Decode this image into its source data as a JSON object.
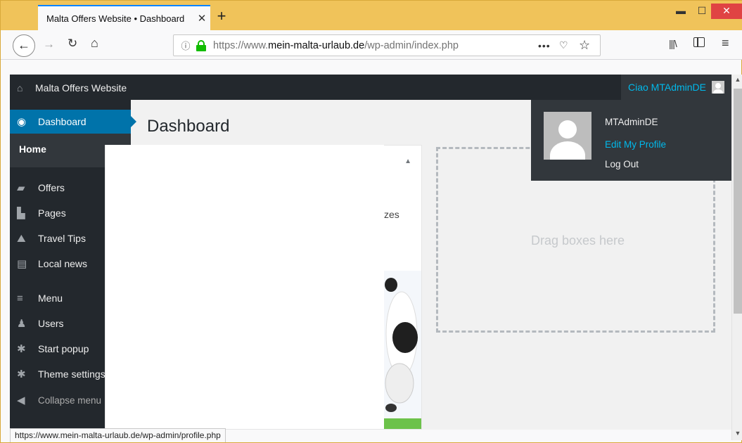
{
  "browser": {
    "tab_title": "Malta Offers Website • Dashboard",
    "tab_close": "✕",
    "new_tab": "+",
    "window_controls": {
      "minimize": "▬",
      "maximize": "☐",
      "close": "✕"
    },
    "url_prefix": "https://www.",
    "url_domain": "mein-malta-urlaub.de",
    "url_path": "/wp-admin/index.php",
    "status_url": "https://www.mein-malta-urlaub.de/wp-admin/profile.php",
    "icons": {
      "back": "back-arrow-icon",
      "forward": "forward-arrow-icon",
      "reload": "reload-icon",
      "home": "home-icon",
      "info": "info-icon",
      "lock": "lock-icon",
      "more": "more-icon",
      "pocket": "pocket-icon",
      "bookmark": "star-icon",
      "library": "library-icon",
      "sidebar": "sidebar-icon",
      "menu": "hamburger-menu-icon"
    }
  },
  "adminbar": {
    "site_name": "Malta Offers Website",
    "greeting": "Ciao MTAdminDE"
  },
  "sidebar": {
    "dashboard": "Dashboard",
    "home": "Home",
    "items": [
      {
        "label": "Offers",
        "icon": "offers-icon"
      },
      {
        "label": "Pages",
        "icon": "pages-icon"
      },
      {
        "label": "Travel Tips",
        "icon": "travel-tips-icon"
      },
      {
        "label": "Local news",
        "icon": "local-news-icon"
      },
      {
        "label": "Menu",
        "icon": "menu-icon"
      },
      {
        "label": "Users",
        "icon": "users-icon"
      },
      {
        "label": "Start popup",
        "icon": "gear-icon"
      },
      {
        "label": "Theme settings",
        "icon": "gear-icon"
      }
    ],
    "collapse": "Collapse menu"
  },
  "main": {
    "title": "Dashboard",
    "widget_partial_text": "zes",
    "dropzone_text": "Drag boxes here"
  },
  "account_menu": {
    "name": "MTAdminDE",
    "edit_profile": "Edit My Profile",
    "logout": "Log Out"
  },
  "colors": {
    "admin_dark": "#23282d",
    "admin_highlight": "#0073aa",
    "link_blue": "#00b9eb",
    "firefox_frame": "#f0c35a"
  }
}
